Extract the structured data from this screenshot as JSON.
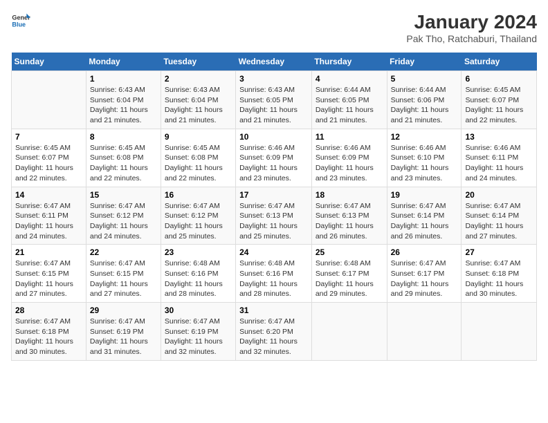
{
  "logo": {
    "line1": "General",
    "line2": "Blue"
  },
  "title": "January 2024",
  "subtitle": "Pak Tho, Ratchaburi, Thailand",
  "headers": [
    "Sunday",
    "Monday",
    "Tuesday",
    "Wednesday",
    "Thursday",
    "Friday",
    "Saturday"
  ],
  "weeks": [
    [
      {
        "day": "",
        "lines": []
      },
      {
        "day": "1",
        "lines": [
          "Sunrise: 6:43 AM",
          "Sunset: 6:04 PM",
          "Daylight: 11 hours",
          "and 21 minutes."
        ]
      },
      {
        "day": "2",
        "lines": [
          "Sunrise: 6:43 AM",
          "Sunset: 6:04 PM",
          "Daylight: 11 hours",
          "and 21 minutes."
        ]
      },
      {
        "day": "3",
        "lines": [
          "Sunrise: 6:43 AM",
          "Sunset: 6:05 PM",
          "Daylight: 11 hours",
          "and 21 minutes."
        ]
      },
      {
        "day": "4",
        "lines": [
          "Sunrise: 6:44 AM",
          "Sunset: 6:05 PM",
          "Daylight: 11 hours",
          "and 21 minutes."
        ]
      },
      {
        "day": "5",
        "lines": [
          "Sunrise: 6:44 AM",
          "Sunset: 6:06 PM",
          "Daylight: 11 hours",
          "and 21 minutes."
        ]
      },
      {
        "day": "6",
        "lines": [
          "Sunrise: 6:45 AM",
          "Sunset: 6:07 PM",
          "Daylight: 11 hours",
          "and 22 minutes."
        ]
      }
    ],
    [
      {
        "day": "7",
        "lines": [
          "Sunrise: 6:45 AM",
          "Sunset: 6:07 PM",
          "Daylight: 11 hours",
          "and 22 minutes."
        ]
      },
      {
        "day": "8",
        "lines": [
          "Sunrise: 6:45 AM",
          "Sunset: 6:08 PM",
          "Daylight: 11 hours",
          "and 22 minutes."
        ]
      },
      {
        "day": "9",
        "lines": [
          "Sunrise: 6:45 AM",
          "Sunset: 6:08 PM",
          "Daylight: 11 hours",
          "and 22 minutes."
        ]
      },
      {
        "day": "10",
        "lines": [
          "Sunrise: 6:46 AM",
          "Sunset: 6:09 PM",
          "Daylight: 11 hours",
          "and 23 minutes."
        ]
      },
      {
        "day": "11",
        "lines": [
          "Sunrise: 6:46 AM",
          "Sunset: 6:09 PM",
          "Daylight: 11 hours",
          "and 23 minutes."
        ]
      },
      {
        "day": "12",
        "lines": [
          "Sunrise: 6:46 AM",
          "Sunset: 6:10 PM",
          "Daylight: 11 hours",
          "and 23 minutes."
        ]
      },
      {
        "day": "13",
        "lines": [
          "Sunrise: 6:46 AM",
          "Sunset: 6:11 PM",
          "Daylight: 11 hours",
          "and 24 minutes."
        ]
      }
    ],
    [
      {
        "day": "14",
        "lines": [
          "Sunrise: 6:47 AM",
          "Sunset: 6:11 PM",
          "Daylight: 11 hours",
          "and 24 minutes."
        ]
      },
      {
        "day": "15",
        "lines": [
          "Sunrise: 6:47 AM",
          "Sunset: 6:12 PM",
          "Daylight: 11 hours",
          "and 24 minutes."
        ]
      },
      {
        "day": "16",
        "lines": [
          "Sunrise: 6:47 AM",
          "Sunset: 6:12 PM",
          "Daylight: 11 hours",
          "and 25 minutes."
        ]
      },
      {
        "day": "17",
        "lines": [
          "Sunrise: 6:47 AM",
          "Sunset: 6:13 PM",
          "Daylight: 11 hours",
          "and 25 minutes."
        ]
      },
      {
        "day": "18",
        "lines": [
          "Sunrise: 6:47 AM",
          "Sunset: 6:13 PM",
          "Daylight: 11 hours",
          "and 26 minutes."
        ]
      },
      {
        "day": "19",
        "lines": [
          "Sunrise: 6:47 AM",
          "Sunset: 6:14 PM",
          "Daylight: 11 hours",
          "and 26 minutes."
        ]
      },
      {
        "day": "20",
        "lines": [
          "Sunrise: 6:47 AM",
          "Sunset: 6:14 PM",
          "Daylight: 11 hours",
          "and 27 minutes."
        ]
      }
    ],
    [
      {
        "day": "21",
        "lines": [
          "Sunrise: 6:47 AM",
          "Sunset: 6:15 PM",
          "Daylight: 11 hours",
          "and 27 minutes."
        ]
      },
      {
        "day": "22",
        "lines": [
          "Sunrise: 6:47 AM",
          "Sunset: 6:15 PM",
          "Daylight: 11 hours",
          "and 27 minutes."
        ]
      },
      {
        "day": "23",
        "lines": [
          "Sunrise: 6:48 AM",
          "Sunset: 6:16 PM",
          "Daylight: 11 hours",
          "and 28 minutes."
        ]
      },
      {
        "day": "24",
        "lines": [
          "Sunrise: 6:48 AM",
          "Sunset: 6:16 PM",
          "Daylight: 11 hours",
          "and 28 minutes."
        ]
      },
      {
        "day": "25",
        "lines": [
          "Sunrise: 6:48 AM",
          "Sunset: 6:17 PM",
          "Daylight: 11 hours",
          "and 29 minutes."
        ]
      },
      {
        "day": "26",
        "lines": [
          "Sunrise: 6:47 AM",
          "Sunset: 6:17 PM",
          "Daylight: 11 hours",
          "and 29 minutes."
        ]
      },
      {
        "day": "27",
        "lines": [
          "Sunrise: 6:47 AM",
          "Sunset: 6:18 PM",
          "Daylight: 11 hours",
          "and 30 minutes."
        ]
      }
    ],
    [
      {
        "day": "28",
        "lines": [
          "Sunrise: 6:47 AM",
          "Sunset: 6:18 PM",
          "Daylight: 11 hours",
          "and 30 minutes."
        ]
      },
      {
        "day": "29",
        "lines": [
          "Sunrise: 6:47 AM",
          "Sunset: 6:19 PM",
          "Daylight: 11 hours",
          "and 31 minutes."
        ]
      },
      {
        "day": "30",
        "lines": [
          "Sunrise: 6:47 AM",
          "Sunset: 6:19 PM",
          "Daylight: 11 hours",
          "and 32 minutes."
        ]
      },
      {
        "day": "31",
        "lines": [
          "Sunrise: 6:47 AM",
          "Sunset: 6:20 PM",
          "Daylight: 11 hours",
          "and 32 minutes."
        ]
      },
      {
        "day": "",
        "lines": []
      },
      {
        "day": "",
        "lines": []
      },
      {
        "day": "",
        "lines": []
      }
    ]
  ]
}
